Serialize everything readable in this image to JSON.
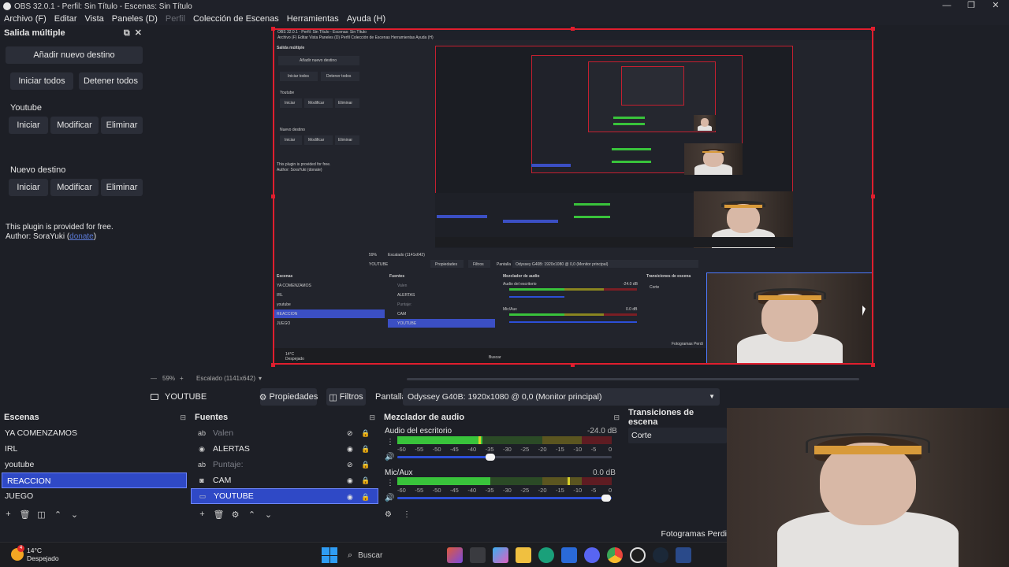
{
  "titlebar": {
    "title": "OBS 32.0.1 - Perfil: Sin Título - Escenas: Sin Título",
    "minimize": "—",
    "maximize": "❐",
    "close": "✕"
  },
  "menu": {
    "items": [
      "Archivo (F)",
      "Editar",
      "Vista",
      "Paneles (D)",
      "Perfil",
      "Colección de Escenas",
      "Herramientas",
      "Ayuda (H)"
    ]
  },
  "multi_output": {
    "title": "Salida múltiple",
    "add_label": "Añadir nuevo destino",
    "start_all": "Iniciar todos",
    "stop_all": "Detener todos",
    "targets": [
      {
        "name": "Youtube",
        "start": "Iniciar",
        "edit": "Modificar",
        "remove": "Eliminar"
      },
      {
        "name": "Nuevo destino",
        "start": "Iniciar",
        "edit": "Modificar",
        "remove": "Eliminar"
      }
    ],
    "note_line1": "This plugin is provided for free.",
    "note_prefix": "Author: SoraYuki (",
    "note_link": "donate",
    "note_suffix": ")"
  },
  "preview": {
    "zoom": "59%",
    "scale": "Escalado (1141x642)",
    "mini": {
      "title": "OBS 32.0.1 - Perfil: Sin Título - Escenas: Sin Título",
      "menu": "Archivo (F)   Editar   Vista   Paneles (D)   Perfil   Colección de Escenas   Herramientas   Ayuda (H)",
      "multi_title": "Salida múltiple",
      "add": "Añadir nuevo destino",
      "start_all": "Iniciar todos",
      "stop_all": "Detener todos",
      "youtube": "Youtube",
      "new_target": "Nuevo destino",
      "start": "Iniciar",
      "edit": "Modificar",
      "remove": "Eliminar",
      "note1": "This plugin is provided for free.",
      "note2": "Author: SoraYuki (donate)",
      "zoom": "59%",
      "scale": "Escalado (1141x642)",
      "source": "YOUTUBE",
      "props": "Propiedades",
      "filters": "Filtros",
      "screen": "Pantalla",
      "monitor": "Odyssey G40B: 1920x1080 @ 0,0 (Monitor principal)",
      "scenes_title": "Escenas",
      "sources_title": "Fuentes",
      "mixer_title": "Mezclador de audio",
      "trans_title": "Transiciones de escena",
      "cut": "Corte",
      "scenes": [
        "YA COMENZAMOS",
        "IRL",
        "youtube",
        "REACCION",
        "JUEGO"
      ],
      "sources": [
        "Valen",
        "ALERTAS",
        "Puntaje:",
        "CAM",
        "YOUTUBE"
      ],
      "desk_audio": "Audio del escritorio",
      "desk_db": "-24.0 dB",
      "mic": "Mic/Aux",
      "mic_db": "0.0 dB",
      "frames": "Fotogramas Perdi",
      "search": "Buscar",
      "temp": "14°C",
      "weather": "Despejado"
    }
  },
  "toolbar": {
    "source_name": "YOUTUBE",
    "properties": "Propiedades",
    "filters": "Filtros",
    "screen_label": "Pantalla",
    "monitor_value": "Odyssey G40B: 1920x1080 @ 0,0 (Monitor principal)"
  },
  "scenes": {
    "title": "Escenas",
    "items": [
      "YA COMENZAMOS",
      "IRL",
      "youtube",
      "REACCION",
      "JUEGO"
    ],
    "selected": "REACCION"
  },
  "sources": {
    "title": "Fuentes",
    "items": [
      {
        "name": "Valen",
        "icon": "text-icon",
        "visible": false
      },
      {
        "name": "ALERTAS",
        "icon": "browser-icon",
        "visible": true
      },
      {
        "name": "Puntaje:",
        "icon": "text-icon",
        "visible": false
      },
      {
        "name": "CAM",
        "icon": "camera-icon",
        "visible": true
      },
      {
        "name": "YOUTUBE",
        "icon": "monitor-icon",
        "visible": true
      }
    ],
    "selected": "YOUTUBE"
  },
  "mixer": {
    "title": "Mezclador de audio",
    "channels": [
      {
        "name": "Audio del escritorio",
        "db": "-24.0 dB",
        "volume": 0.44
      },
      {
        "name": "Mic/Aux",
        "db": "0.0 dB",
        "volume": 1.0
      }
    ],
    "ticks": [
      "-60",
      "-55",
      "-50",
      "-45",
      "-40",
      "-35",
      "-30",
      "-25",
      "-20",
      "-15",
      "-10",
      "-5",
      "0"
    ]
  },
  "transitions": {
    "title": "Transiciones de escena",
    "current": "Corte"
  },
  "status": {
    "frames": "Fotogramas Perdi"
  },
  "taskbar": {
    "temp": "14°C",
    "weather": "Despejado",
    "badge": "4",
    "search_placeholder": "Buscar"
  },
  "colors": {
    "accent": "#2f49c6",
    "preview_border": "#e01e2e",
    "meter_green": "#39c33b",
    "meter_yellow": "#8a8520",
    "meter_red": "#7a1e24"
  }
}
